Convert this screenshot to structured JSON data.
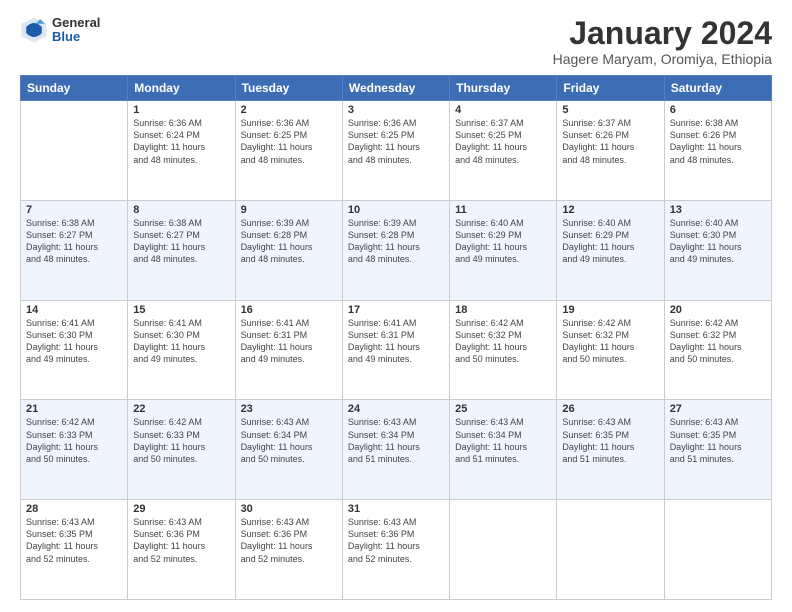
{
  "logo": {
    "general": "General",
    "blue": "Blue"
  },
  "title": "January 2024",
  "subtitle": "Hagere Maryam, Oromiya, Ethiopia",
  "days_of_week": [
    "Sunday",
    "Monday",
    "Tuesday",
    "Wednesday",
    "Thursday",
    "Friday",
    "Saturday"
  ],
  "weeks": [
    [
      {
        "num": "",
        "info": ""
      },
      {
        "num": "1",
        "info": "Sunrise: 6:36 AM\nSunset: 6:24 PM\nDaylight: 11 hours\nand 48 minutes."
      },
      {
        "num": "2",
        "info": "Sunrise: 6:36 AM\nSunset: 6:25 PM\nDaylight: 11 hours\nand 48 minutes."
      },
      {
        "num": "3",
        "info": "Sunrise: 6:36 AM\nSunset: 6:25 PM\nDaylight: 11 hours\nand 48 minutes."
      },
      {
        "num": "4",
        "info": "Sunrise: 6:37 AM\nSunset: 6:25 PM\nDaylight: 11 hours\nand 48 minutes."
      },
      {
        "num": "5",
        "info": "Sunrise: 6:37 AM\nSunset: 6:26 PM\nDaylight: 11 hours\nand 48 minutes."
      },
      {
        "num": "6",
        "info": "Sunrise: 6:38 AM\nSunset: 6:26 PM\nDaylight: 11 hours\nand 48 minutes."
      }
    ],
    [
      {
        "num": "7",
        "info": "Sunrise: 6:38 AM\nSunset: 6:27 PM\nDaylight: 11 hours\nand 48 minutes."
      },
      {
        "num": "8",
        "info": "Sunrise: 6:38 AM\nSunset: 6:27 PM\nDaylight: 11 hours\nand 48 minutes."
      },
      {
        "num": "9",
        "info": "Sunrise: 6:39 AM\nSunset: 6:28 PM\nDaylight: 11 hours\nand 48 minutes."
      },
      {
        "num": "10",
        "info": "Sunrise: 6:39 AM\nSunset: 6:28 PM\nDaylight: 11 hours\nand 48 minutes."
      },
      {
        "num": "11",
        "info": "Sunrise: 6:40 AM\nSunset: 6:29 PM\nDaylight: 11 hours\nand 49 minutes."
      },
      {
        "num": "12",
        "info": "Sunrise: 6:40 AM\nSunset: 6:29 PM\nDaylight: 11 hours\nand 49 minutes."
      },
      {
        "num": "13",
        "info": "Sunrise: 6:40 AM\nSunset: 6:30 PM\nDaylight: 11 hours\nand 49 minutes."
      }
    ],
    [
      {
        "num": "14",
        "info": "Sunrise: 6:41 AM\nSunset: 6:30 PM\nDaylight: 11 hours\nand 49 minutes."
      },
      {
        "num": "15",
        "info": "Sunrise: 6:41 AM\nSunset: 6:30 PM\nDaylight: 11 hours\nand 49 minutes."
      },
      {
        "num": "16",
        "info": "Sunrise: 6:41 AM\nSunset: 6:31 PM\nDaylight: 11 hours\nand 49 minutes."
      },
      {
        "num": "17",
        "info": "Sunrise: 6:41 AM\nSunset: 6:31 PM\nDaylight: 11 hours\nand 49 minutes."
      },
      {
        "num": "18",
        "info": "Sunrise: 6:42 AM\nSunset: 6:32 PM\nDaylight: 11 hours\nand 50 minutes."
      },
      {
        "num": "19",
        "info": "Sunrise: 6:42 AM\nSunset: 6:32 PM\nDaylight: 11 hours\nand 50 minutes."
      },
      {
        "num": "20",
        "info": "Sunrise: 6:42 AM\nSunset: 6:32 PM\nDaylight: 11 hours\nand 50 minutes."
      }
    ],
    [
      {
        "num": "21",
        "info": "Sunrise: 6:42 AM\nSunset: 6:33 PM\nDaylight: 11 hours\nand 50 minutes."
      },
      {
        "num": "22",
        "info": "Sunrise: 6:42 AM\nSunset: 6:33 PM\nDaylight: 11 hours\nand 50 minutes."
      },
      {
        "num": "23",
        "info": "Sunrise: 6:43 AM\nSunset: 6:34 PM\nDaylight: 11 hours\nand 50 minutes."
      },
      {
        "num": "24",
        "info": "Sunrise: 6:43 AM\nSunset: 6:34 PM\nDaylight: 11 hours\nand 51 minutes."
      },
      {
        "num": "25",
        "info": "Sunrise: 6:43 AM\nSunset: 6:34 PM\nDaylight: 11 hours\nand 51 minutes."
      },
      {
        "num": "26",
        "info": "Sunrise: 6:43 AM\nSunset: 6:35 PM\nDaylight: 11 hours\nand 51 minutes."
      },
      {
        "num": "27",
        "info": "Sunrise: 6:43 AM\nSunset: 6:35 PM\nDaylight: 11 hours\nand 51 minutes."
      }
    ],
    [
      {
        "num": "28",
        "info": "Sunrise: 6:43 AM\nSunset: 6:35 PM\nDaylight: 11 hours\nand 52 minutes."
      },
      {
        "num": "29",
        "info": "Sunrise: 6:43 AM\nSunset: 6:36 PM\nDaylight: 11 hours\nand 52 minutes."
      },
      {
        "num": "30",
        "info": "Sunrise: 6:43 AM\nSunset: 6:36 PM\nDaylight: 11 hours\nand 52 minutes."
      },
      {
        "num": "31",
        "info": "Sunrise: 6:43 AM\nSunset: 6:36 PM\nDaylight: 11 hours\nand 52 minutes."
      },
      {
        "num": "",
        "info": ""
      },
      {
        "num": "",
        "info": ""
      },
      {
        "num": "",
        "info": ""
      }
    ]
  ]
}
